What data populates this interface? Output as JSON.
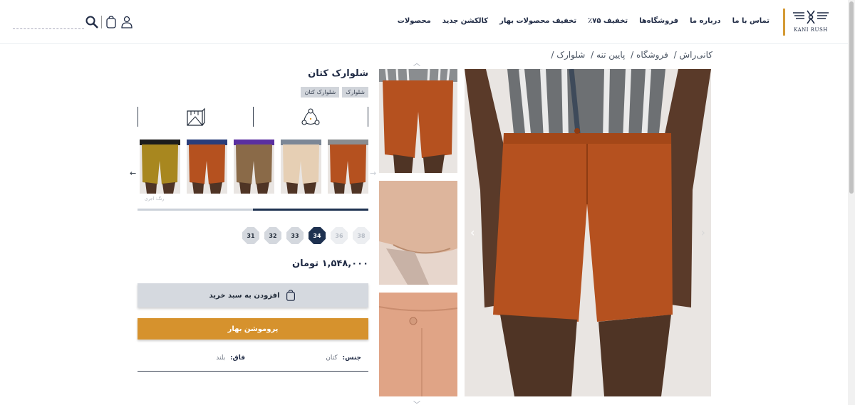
{
  "header": {
    "logo_text": "KANI RUSH",
    "nav": [
      "محصولات",
      "کالکشن جدید",
      "تخفیف محصولات بهار",
      "تخفیف ۷۵٪",
      "فروشگاه‌ها",
      "درباره ما",
      "تماس با ما"
    ],
    "search_placeholder": ""
  },
  "breadcrumb": [
    "کانی‌راش /",
    "فروشگاه /",
    "پایین تنه /",
    "شلوارک /"
  ],
  "product": {
    "title": "شلوارک کتان",
    "tags": [
      "شلوارک",
      "شلوارک کتان"
    ],
    "color_label": "رنگ: آجری",
    "color_progress": 0.5,
    "sizes": [
      {
        "label": "38",
        "state": "disabled"
      },
      {
        "label": "36",
        "state": "disabled"
      },
      {
        "label": "34",
        "state": "active"
      },
      {
        "label": "33",
        "state": "normal"
      },
      {
        "label": "32",
        "state": "normal"
      },
      {
        "label": "31",
        "state": "normal"
      }
    ],
    "price": "۱,۵۴۸,۰۰۰ تومان",
    "add_to_cart_label": "افزودن به سبد خرید",
    "promo_label": "پروموشن بهار",
    "attributes": [
      {
        "key": "جنس:",
        "value": "کتان"
      },
      {
        "key": "فاق:",
        "value": "بلند"
      }
    ]
  },
  "colors": {
    "accent": "#d6922d",
    "navy": "#1e3150",
    "product_orange": "#b5511f"
  },
  "variant_colors": [
    "#b5511f",
    "#e6cfb4",
    "#8a6a48",
    "#b5511f",
    "#a8871f"
  ]
}
